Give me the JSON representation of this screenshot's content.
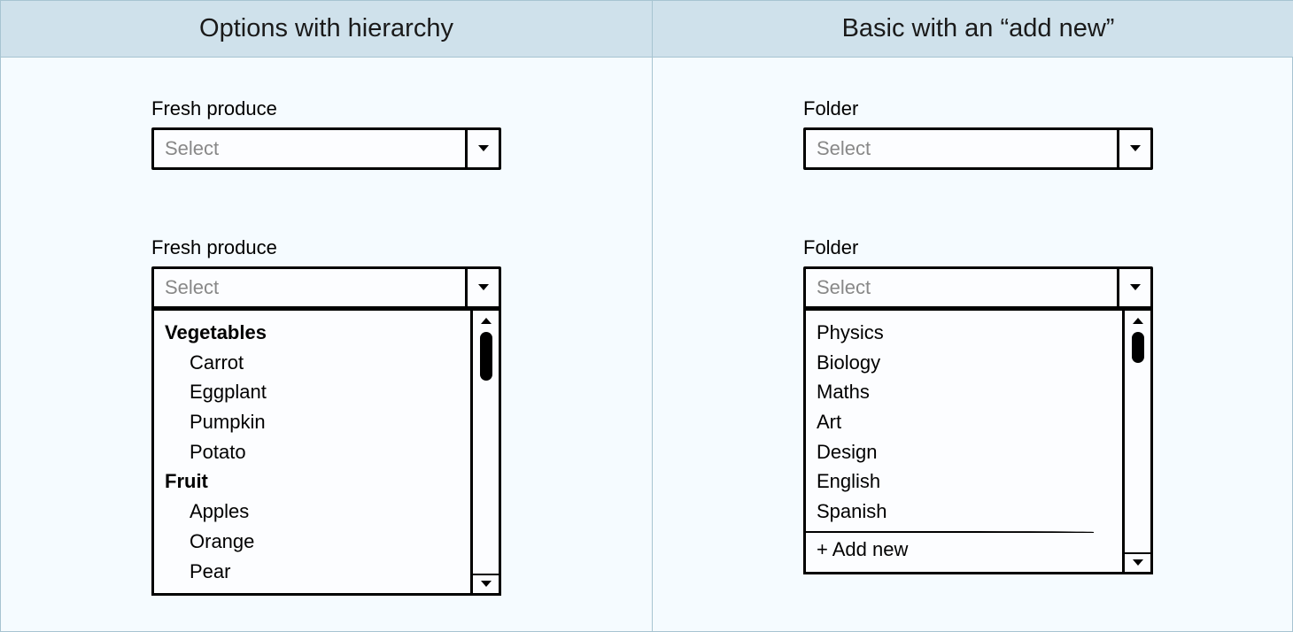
{
  "left": {
    "title": "Options with hierarchy",
    "field1": {
      "label": "Fresh produce",
      "placeholder": "Select"
    },
    "field2": {
      "label": "Fresh produce",
      "placeholder": "Select",
      "groups": [
        {
          "name": "Vegetables",
          "items": [
            "Carrot",
            "Eggplant",
            "Pumpkin",
            "Potato"
          ]
        },
        {
          "name": "Fruit",
          "items": [
            "Apples",
            "Orange",
            "Pear"
          ]
        }
      ]
    }
  },
  "right": {
    "title": "Basic with an “add new”",
    "field1": {
      "label": "Folder",
      "placeholder": "Select"
    },
    "field2": {
      "label": "Folder",
      "placeholder": "Select",
      "items": [
        "Physics",
        "Biology",
        "Maths",
        "Art",
        "Design",
        "English",
        "Spanish"
      ],
      "addNew": "+ Add new"
    }
  }
}
